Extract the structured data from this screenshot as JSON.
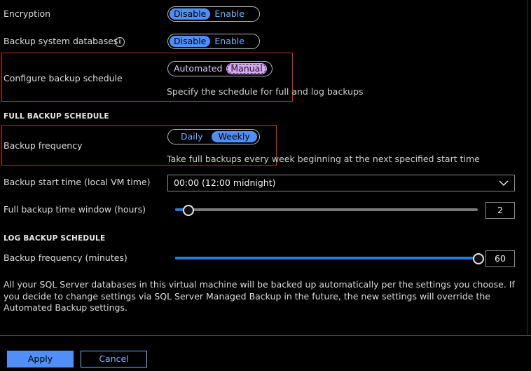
{
  "encryption": {
    "label": "Encryption",
    "options": [
      "Disable",
      "Enable"
    ],
    "selected": "Disable"
  },
  "backup_system_databases": {
    "label": "Backup system databases",
    "info_icon": "info-icon",
    "options": [
      "Disable",
      "Enable"
    ],
    "selected": "Disable"
  },
  "configure_schedule": {
    "label": "Configure backup schedule",
    "options": [
      "Automated",
      "Manual"
    ],
    "selected": "Manual",
    "hint": "Specify the schedule for full and log backups"
  },
  "full_backup": {
    "section_title": "FULL BACKUP SCHEDULE",
    "frequency": {
      "label": "Backup frequency",
      "options": [
        "Daily",
        "Weekly"
      ],
      "selected": "Weekly",
      "hint": "Take full backups every week beginning at the next specified start time"
    },
    "start_time": {
      "label": "Backup start time (local VM time)",
      "value": "00:00 (12:00 midnight)"
    },
    "time_window": {
      "label": "Full backup time window (hours)",
      "value": "2"
    }
  },
  "log_backup": {
    "section_title": "LOG BACKUP SCHEDULE",
    "frequency": {
      "label": "Backup frequency (minutes)",
      "value": "60"
    }
  },
  "note": "All your SQL Server databases in this virtual machine will be backed up automatically per the settings you choose. If you decide to change settings via SQL Server Managed Backup in the future, the new settings will override the Automated Backup settings.",
  "buttons": {
    "apply": "Apply",
    "cancel": "Cancel"
  },
  "colors": {
    "accent": "#4f8ff7",
    "highlight_box": "#d9261c",
    "schedule_selected": "#d7a8f5"
  }
}
